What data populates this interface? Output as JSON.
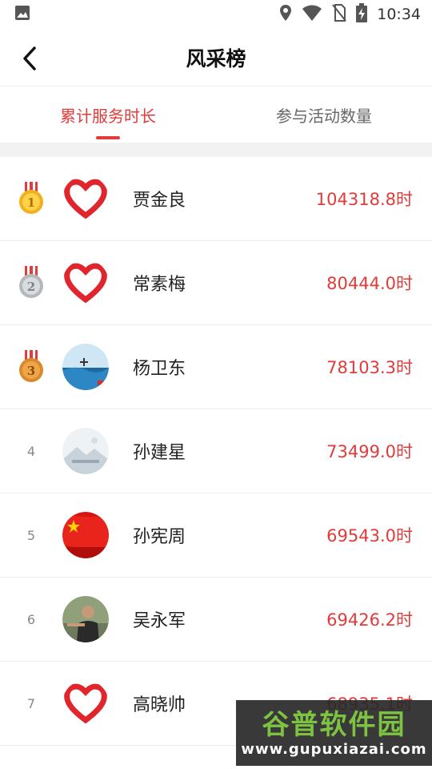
{
  "status_bar": {
    "time": "10:34",
    "icons": [
      "image-icon",
      "location-icon",
      "wifi-icon",
      "no-sim-icon",
      "battery-charging-icon"
    ]
  },
  "header": {
    "title": "风采榜",
    "back_icon": "chevron-left-icon"
  },
  "tabs": [
    {
      "label": "累计服务时长",
      "active": true
    },
    {
      "label": "参与活动数量",
      "active": false
    }
  ],
  "colors": {
    "accent": "#e33a3a",
    "gold": "#f2b01e",
    "silver": "#b5b8bb",
    "bronze": "#d98a2b"
  },
  "ranking": [
    {
      "rank": "1",
      "medal": "gold",
      "avatar": "heart-logo",
      "name": "贾金良",
      "value": "104318.8时"
    },
    {
      "rank": "2",
      "medal": "silver",
      "avatar": "heart-logo",
      "name": "常素梅",
      "value": "80444.0时"
    },
    {
      "rank": "3",
      "medal": "bronze",
      "avatar": "sea-photo",
      "name": "杨卫东",
      "value": "78103.3时"
    },
    {
      "rank": "4",
      "medal": "",
      "avatar": "placeholder-image",
      "name": "孙建星",
      "value": "73499.0时"
    },
    {
      "rank": "5",
      "medal": "",
      "avatar": "flag-photo",
      "name": "孙宪周",
      "value": "69543.0时"
    },
    {
      "rank": "6",
      "medal": "",
      "avatar": "person-photo",
      "name": "吴永军",
      "value": "69426.2时"
    },
    {
      "rank": "7",
      "medal": "",
      "avatar": "heart-logo",
      "name": "高晓帅",
      "value": "68935.1时"
    }
  ],
  "watermark": {
    "title": "谷普软件园",
    "url": "www.gupuxiazai.com"
  }
}
